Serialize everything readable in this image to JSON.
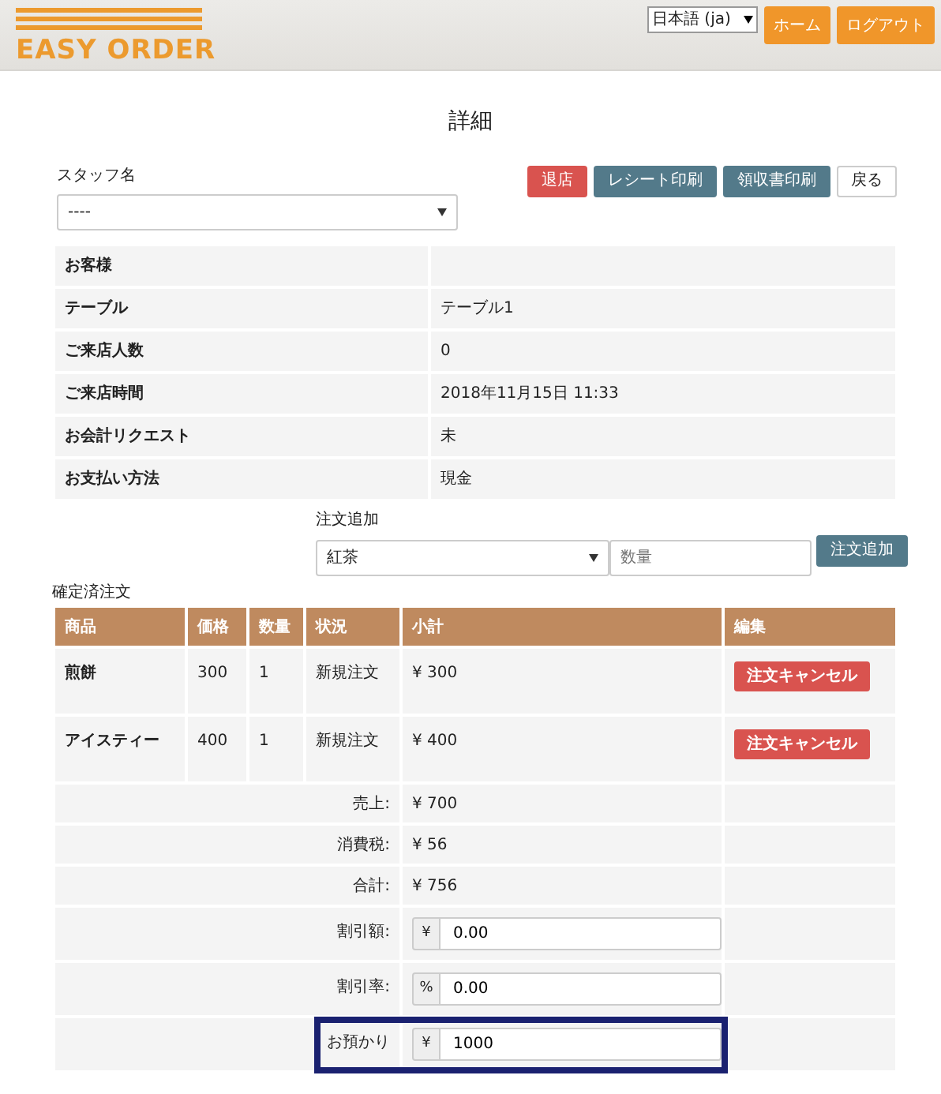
{
  "header": {
    "logo": "EASY ORDER",
    "language": "日本語 (ja)",
    "buttons": [
      "ホーム",
      "ログアウト"
    ]
  },
  "title": "詳細",
  "staff": {
    "label": "スタッフ名",
    "value": "----"
  },
  "actions": [
    {
      "label": "退店",
      "kind": "danger"
    },
    {
      "label": "レシート印刷",
      "kind": "secondary"
    },
    {
      "label": "領収書印刷",
      "kind": "secondary"
    },
    {
      "label": "戻る",
      "kind": "plain"
    }
  ],
  "info": [
    {
      "label": "お客様"
    },
    {
      "label": "テーブル",
      "value": "テーブル1"
    },
    {
      "label": "ご来店人数",
      "value": "0"
    },
    {
      "label": "ご来店時間",
      "value": "2018年11月15日 11:33"
    },
    {
      "label": "お会計リクエスト",
      "value": "未"
    },
    {
      "label": "お支払い方法",
      "value": "現金"
    }
  ],
  "order_add": {
    "label": "注文追加",
    "item": "紅茶",
    "quantity_placeholder": "数量",
    "button": "注文追加"
  },
  "orders": {
    "title": "確定済注文",
    "columns": [
      "商品",
      "価格",
      "数量",
      "状況",
      "小計",
      "編集"
    ],
    "rows": [
      {
        "product": "煎餅",
        "price": "300",
        "quantity": "1",
        "status": "新規注文",
        "subtotal": "¥ 300",
        "action": "注文キャンセル"
      },
      {
        "product": "アイスティー",
        "price": "400",
        "quantity": "1",
        "status": "新規注文",
        "subtotal": "¥ 400",
        "action": "注文キャンセル"
      }
    ],
    "summary": [
      {
        "kind": "text",
        "label": "売上:",
        "value": "¥ 700"
      },
      {
        "kind": "text",
        "label": "消費税:",
        "value": "¥ 56"
      },
      {
        "kind": "text",
        "label": "合計:",
        "value": "¥ 756"
      },
      {
        "kind": "input",
        "label": "割引額:",
        "prefix": "¥",
        "value": "0.00"
      },
      {
        "kind": "input",
        "label": "割引率:",
        "prefix": "%",
        "value": "0.00"
      },
      {
        "kind": "input",
        "label": "お預かり",
        "prefix": "¥",
        "value": "1000",
        "highlighted": true
      }
    ]
  }
}
